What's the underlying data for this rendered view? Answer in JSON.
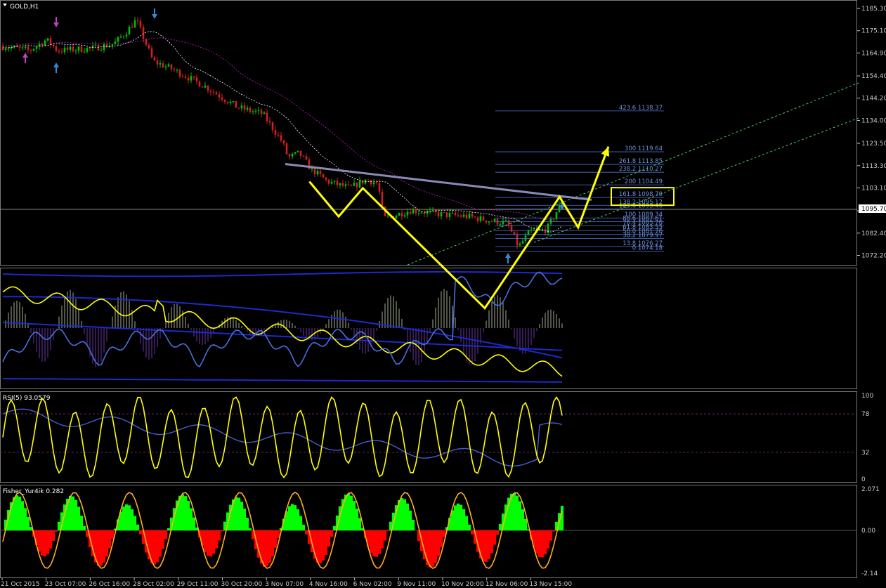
{
  "window": {
    "title": "GOLD,H1"
  },
  "price_axis": {
    "labels": [
      "1185.30",
      "1175.10",
      "1164.90",
      "1154.40",
      "1144.20",
      "1134.00",
      "1123.50",
      "1113.30",
      "1103.10",
      "1092.60",
      "1082.40",
      "1072.20"
    ],
    "current_price_tag": "1095.70"
  },
  "time_axis": {
    "labels": [
      "21 Oct 2015",
      "23 Oct 07:00",
      "26 Oct 16:00",
      "28 Oct 02:00",
      "29 Oct 11:00",
      "30 Oct 20:00",
      "3 Nov 07:00",
      "4 Nov 16:00",
      "6 Nov 02:00",
      "9 Nov 11:00",
      "10 Nov 20:00",
      "12 Nov 06:00",
      "13 Nov 15:00"
    ]
  },
  "fibonacci": {
    "levels": [
      {
        "text": "423.6  1138.37",
        "price": 1138.37
      },
      {
        "text": "300  1119.64",
        "price": 1119.64
      },
      {
        "text": "261.8  1113.85",
        "price": 1113.85
      },
      {
        "text": "238.2  1110.27",
        "price": 1110.27
      },
      {
        "text": "200  1104.49",
        "price": 1104.49
      },
      {
        "text": "161.8  1098.70",
        "price": 1098.7
      },
      {
        "text": "138.2  1095.12",
        "price": 1095.12
      },
      {
        "text": "123.6  1093.46",
        "price": 1093.46
      },
      {
        "text": "100  1089.34",
        "price": 1089.34
      },
      {
        "text": "88.6  1087.61",
        "price": 1087.61
      },
      {
        "text": "76.4  1085.76",
        "price": 1085.76
      },
      {
        "text": "61.8  1083.55",
        "price": 1083.55
      },
      {
        "text": "50.0  1081.76",
        "price": 1081.76
      },
      {
        "text": "38.2  1079.97",
        "price": 1079.97
      },
      {
        "text": "13.8  1076.27",
        "price": 1076.27
      },
      {
        "text": "0  1074.18",
        "price": 1074.18
      }
    ],
    "highlighted": "161.8  1098.70"
  },
  "rsi_panel": {
    "title": "RSI(5) 93.0579",
    "axis_labels": [
      "100",
      "78",
      "32",
      "0"
    ]
  },
  "fisher_panel": {
    "title": "Fisher_Yur4ik 0.282",
    "axis_labels": [
      "2.071",
      "0.00",
      "-2.14"
    ]
  },
  "colors": {
    "background": "#000000",
    "bull_candle": "#00c000",
    "bear_candle": "#d02020",
    "annotation": "#ffff00",
    "trendline": "#8a8ab8",
    "fib": "#5070d0",
    "rsi_line": "#ffff00",
    "fisher_up": "#00ff00",
    "fisher_down": "#ff0000",
    "band": "#1c2acc"
  },
  "chart_data": {
    "type": "candlestick",
    "symbol": "GOLD",
    "timeframe": "H1",
    "ylim": [
      1068,
      1190
    ],
    "waypoints": [
      {
        "t": 0,
        "p": 1168
      },
      {
        "t": 0.05,
        "p": 1166
      },
      {
        "t": 0.08,
        "p": 1171
      },
      {
        "t": 0.1,
        "p": 1166
      },
      {
        "t": 0.16,
        "p": 1167
      },
      {
        "t": 0.2,
        "p": 1169
      },
      {
        "t": 0.22,
        "p": 1174
      },
      {
        "t": 0.24,
        "p": 1180
      },
      {
        "t": 0.27,
        "p": 1161
      },
      {
        "t": 0.3,
        "p": 1158
      },
      {
        "t": 0.36,
        "p": 1150
      },
      {
        "t": 0.42,
        "p": 1140
      },
      {
        "t": 0.465,
        "p": 1137
      },
      {
        "t": 0.5,
        "p": 1124
      },
      {
        "t": 0.51,
        "p": 1117
      },
      {
        "t": 0.53,
        "p": 1119
      },
      {
        "t": 0.55,
        "p": 1112
      },
      {
        "t": 0.58,
        "p": 1106
      },
      {
        "t": 0.62,
        "p": 1103
      },
      {
        "t": 0.65,
        "p": 1107
      },
      {
        "t": 0.67,
        "p": 1105
      },
      {
        "t": 0.68,
        "p": 1089
      },
      {
        "t": 0.73,
        "p": 1093
      },
      {
        "t": 0.78,
        "p": 1091
      },
      {
        "t": 0.83,
        "p": 1090
      },
      {
        "t": 0.87,
        "p": 1088
      },
      {
        "t": 0.9,
        "p": 1087
      },
      {
        "t": 0.92,
        "p": 1076
      },
      {
        "t": 0.94,
        "p": 1083
      },
      {
        "t": 0.97,
        "p": 1084
      },
      {
        "t": 1.0,
        "p": 1098
      }
    ],
    "projection_path": [
      {
        "t": 0.548,
        "p": 1106
      },
      {
        "t": 0.6,
        "p": 1090
      },
      {
        "t": 0.643,
        "p": 1103
      },
      {
        "t": 0.86,
        "p": 1048
      },
      {
        "t": 0.993,
        "p": 1099
      },
      {
        "t": 1.026,
        "p": 1085
      },
      {
        "t": 1.08,
        "p": 1122
      }
    ],
    "neckline": [
      {
        "t": 0.505,
        "p": 1115
      },
      {
        "t": 1.05,
        "p": 1097
      }
    ],
    "rsi_levels": [
      100,
      78,
      32,
      0
    ],
    "fisher_range": [
      -2.14,
      2.071
    ]
  }
}
